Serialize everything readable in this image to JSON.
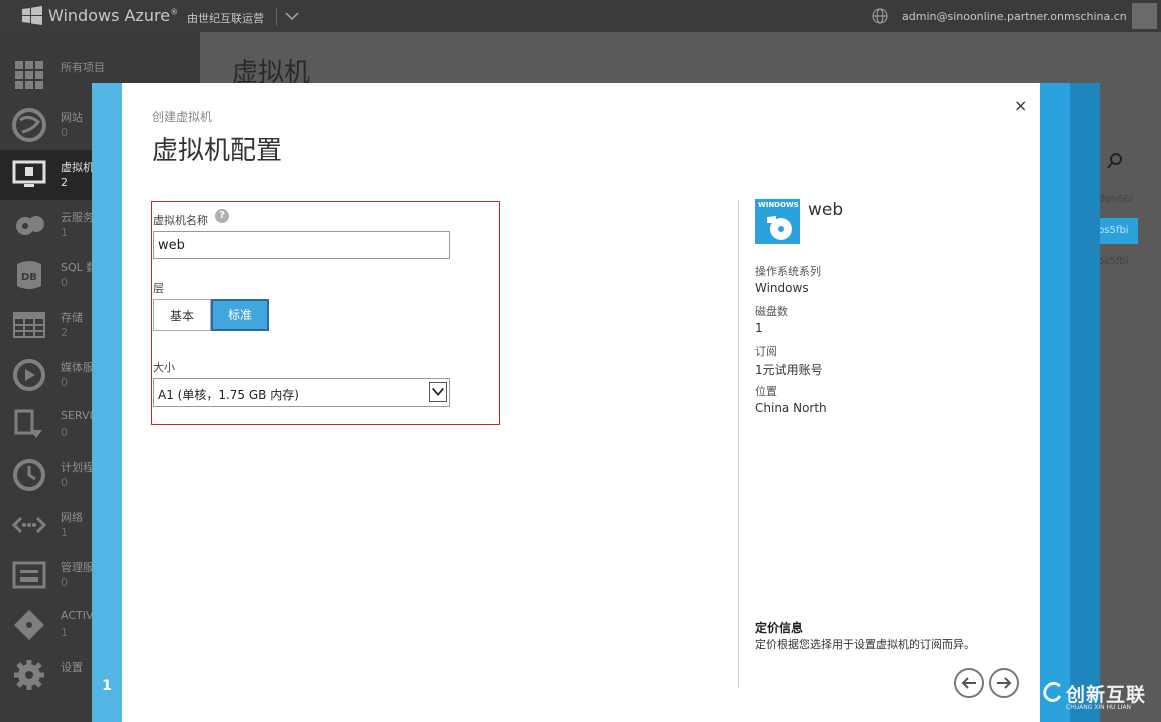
{
  "topbar": {
    "brand": "Windows Azure",
    "brand_mark": "®",
    "subscription": "由世纪互联运营",
    "user": "admin@sinoonline.partner.onmschina.cn"
  },
  "sidebar": {
    "items": [
      {
        "label": "所有项目",
        "count": "",
        "icon": "grid-icon"
      },
      {
        "label": "网站",
        "count": "0",
        "icon": "globe-icon"
      },
      {
        "label": "虚拟机",
        "count": "2",
        "icon": "monitor-icon"
      },
      {
        "label": "云服务",
        "count": "1",
        "icon": "cloud-gear-icon"
      },
      {
        "label": "SQL 数",
        "count": "0",
        "icon": "db-icon"
      },
      {
        "label": "存储",
        "count": "2",
        "icon": "table-icon"
      },
      {
        "label": "媒体服",
        "count": "0",
        "icon": "media-icon"
      },
      {
        "label": "SERVI",
        "count": "0",
        "icon": "service-bus-icon"
      },
      {
        "label": "计划程",
        "count": "0",
        "icon": "clock-icon"
      },
      {
        "label": "网络",
        "count": "1",
        "icon": "network-icon"
      },
      {
        "label": "管理服",
        "count": "0",
        "icon": "management-icon"
      },
      {
        "label": "ACTIV",
        "count": "1",
        "icon": "diamond-icon"
      },
      {
        "label": "设置",
        "count": "",
        "icon": "settings-icon"
      }
    ]
  },
  "background": {
    "title": "虚拟机",
    "rows": [
      "dqh66l",
      "bs5fbi",
      "bs5fbi"
    ]
  },
  "modal": {
    "step": "1",
    "subtitle": "创建虚拟机",
    "title": "虚拟机配置",
    "close": "×",
    "form": {
      "name_label": "虚拟机名称",
      "name_value": "web",
      "tier_label": "层",
      "tier_basic": "基本",
      "tier_standard": "标准",
      "size_label": "大小",
      "size_value": "A1 (单核，1.75 GB 内存)"
    },
    "summary": {
      "badge": "WINDOWS",
      "vm_name": "web",
      "os_family_label": "操作系统系列",
      "os_family": "Windows",
      "disk_count_label": "磁盘数",
      "disk_count": "1",
      "subscription_label": "订阅",
      "subscription": "1元试用账号",
      "location_label": "位置",
      "location": "China North",
      "pricing_title": "定价信息",
      "pricing_text": "定价根据您选择用于设置虚拟机的订阅而异。"
    }
  },
  "watermark": {
    "text": "创新互联",
    "sub": "CHUANG XIN HU LIAN"
  },
  "colors": {
    "accent": "#41a6dd",
    "highlight_border": "#d0242a"
  }
}
